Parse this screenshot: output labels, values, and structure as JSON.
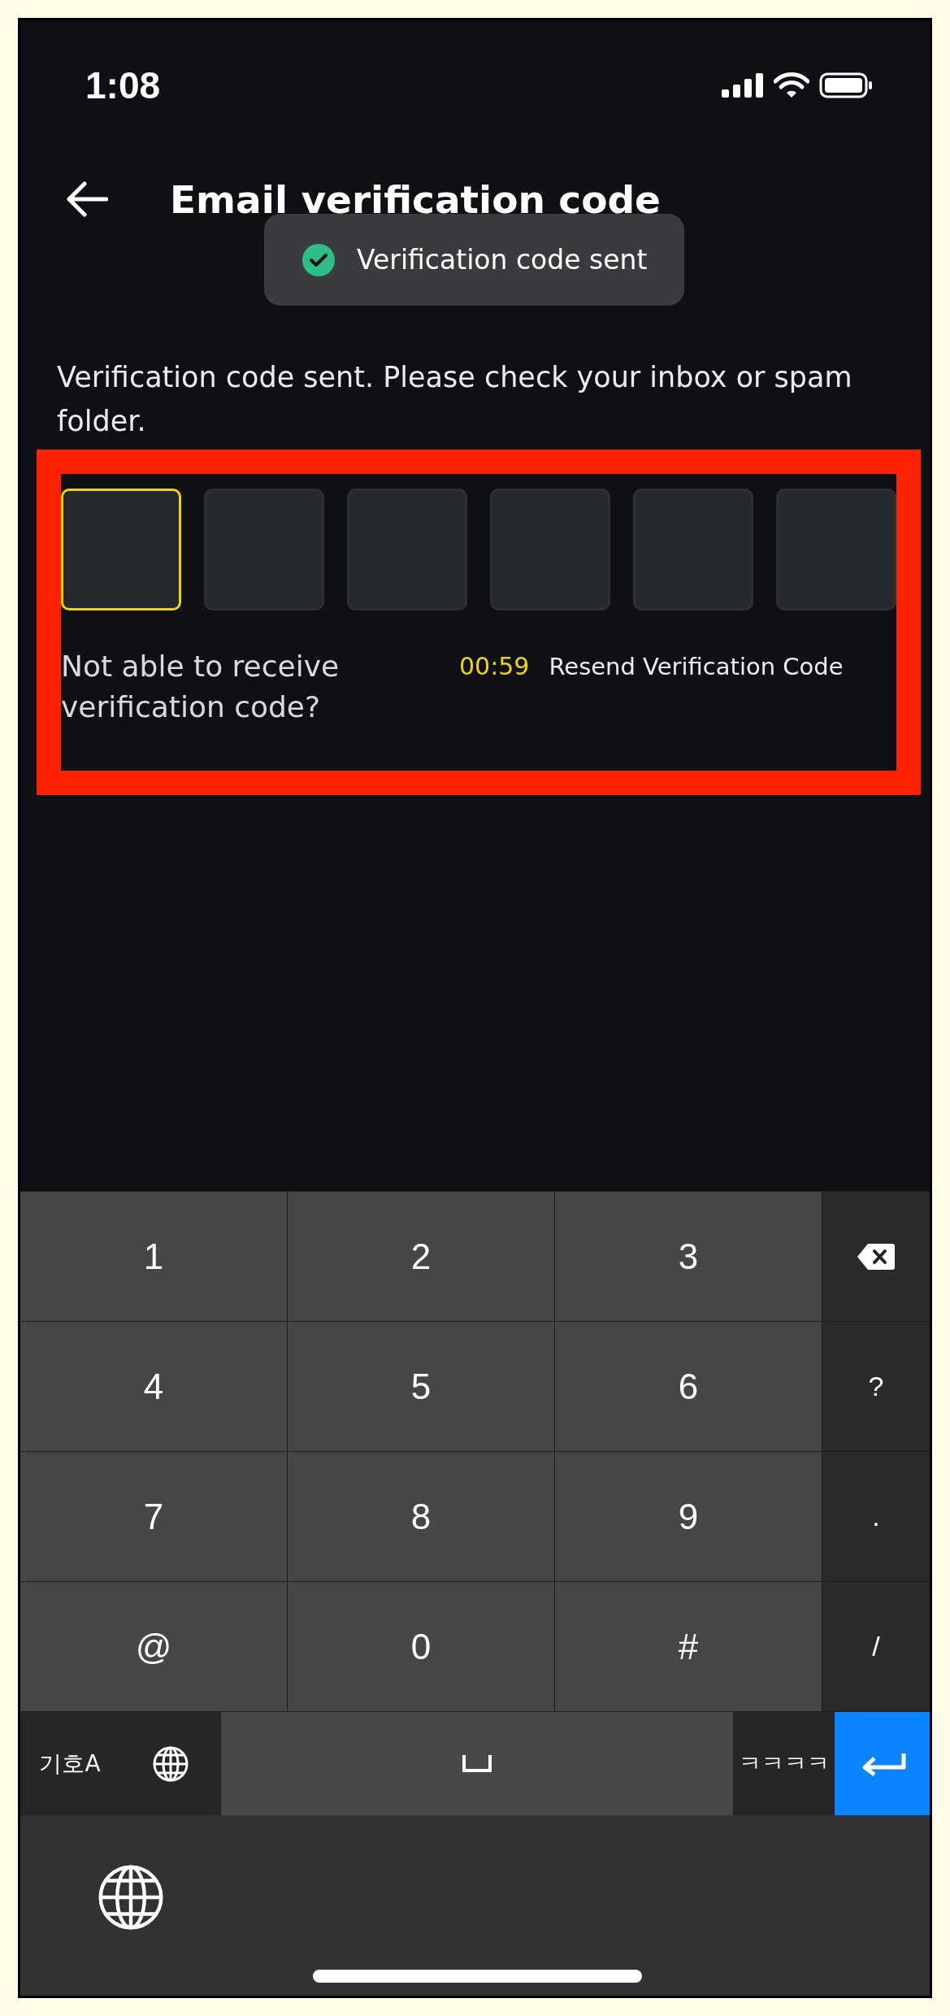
{
  "status_bar": {
    "time": "1:08"
  },
  "header": {
    "title": "Email verification code"
  },
  "toast": {
    "text": "Verification code sent"
  },
  "message": "Verification code sent. Please check your inbox or spam folder.",
  "code_boxes": [
    {
      "focused": true
    },
    {
      "focused": false
    },
    {
      "focused": false
    },
    {
      "focused": false
    },
    {
      "focused": false
    },
    {
      "focused": false
    }
  ],
  "help_link": "Not able to receive verification code?",
  "timer": "00:59",
  "resend": "Resend Verification Code",
  "keyboard": {
    "keys": [
      {
        "kind": "key",
        "label": "1"
      },
      {
        "kind": "key",
        "label": "2"
      },
      {
        "kind": "key",
        "label": "3"
      },
      {
        "kind": "backspace"
      },
      {
        "kind": "key",
        "label": "4"
      },
      {
        "kind": "key",
        "label": "5"
      },
      {
        "kind": "key",
        "label": "6"
      },
      {
        "kind": "side",
        "label": "?"
      },
      {
        "kind": "key",
        "label": "7"
      },
      {
        "kind": "key",
        "label": "8"
      },
      {
        "kind": "key",
        "label": "9"
      },
      {
        "kind": "side",
        "label": "."
      },
      {
        "kind": "key",
        "label": "@"
      },
      {
        "kind": "key",
        "label": "0"
      },
      {
        "kind": "key",
        "label": "#"
      },
      {
        "kind": "side",
        "label": "/"
      }
    ],
    "bottom_row": [
      {
        "kind": "mode",
        "label": "기호A"
      },
      {
        "kind": "globe"
      },
      {
        "kind": "space"
      },
      {
        "kind": "mode",
        "label": "ㅋㅋㅋㅋ"
      },
      {
        "kind": "enter"
      }
    ]
  }
}
